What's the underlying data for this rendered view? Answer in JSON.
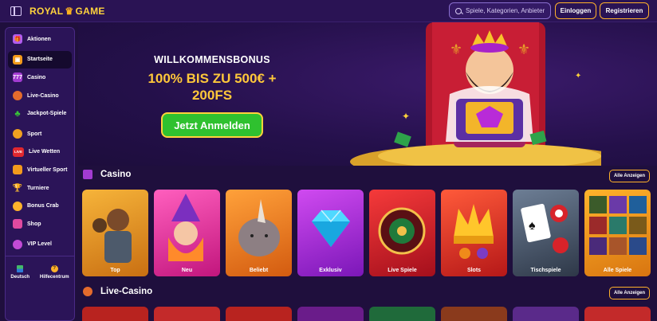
{
  "header": {
    "logo_left": "ROYAL",
    "logo_right": "GAME",
    "search_placeholder": "Spiele, Kategorien, Anbieter",
    "login": "Einloggen",
    "register": "Registrieren"
  },
  "sidebar": {
    "items": [
      {
        "label": "Aktionen",
        "icon": "gift-icon"
      },
      {
        "label": "Startseite",
        "icon": "home-icon"
      },
      {
        "label": "Casino",
        "icon": "slot-icon"
      },
      {
        "label": "Live-Casino",
        "icon": "dealer-icon"
      },
      {
        "label": "Jackpot-Spiele",
        "icon": "clover-icon"
      },
      {
        "label": "Sport",
        "icon": "ball-icon"
      },
      {
        "label": "Live Wetten",
        "icon": "live-icon"
      },
      {
        "label": "Virtueller Sport",
        "icon": "gamepad-icon"
      },
      {
        "label": "Turniere",
        "icon": "trophy-icon"
      },
      {
        "label": "Bonus Crab",
        "icon": "crab-icon"
      },
      {
        "label": "Shop",
        "icon": "shop-icon"
      },
      {
        "label": "VIP Level",
        "icon": "vip-icon"
      }
    ],
    "footer": {
      "language": "Deutsch",
      "help": "Hilfecentrum"
    }
  },
  "hero": {
    "heading": "WILLKOMMENSBONUS",
    "line1": "100% BIS ZU 500€ +",
    "line2": "200FS",
    "cta": "Jetzt Anmelden"
  },
  "casino": {
    "title": "Casino",
    "all": "Alle Anzeigen",
    "cards": [
      "Top",
      "Neu",
      "Beliebt",
      "Exklusiv",
      "Live Spiele",
      "Slots",
      "Tischspiele",
      "Alle Spiele"
    ]
  },
  "live": {
    "title": "Live-Casino",
    "all": "Alle Anzeigen"
  },
  "colors": {
    "accent": "#ffb12b",
    "cta": "#2fc12f",
    "bg": "#1f0f3d"
  }
}
